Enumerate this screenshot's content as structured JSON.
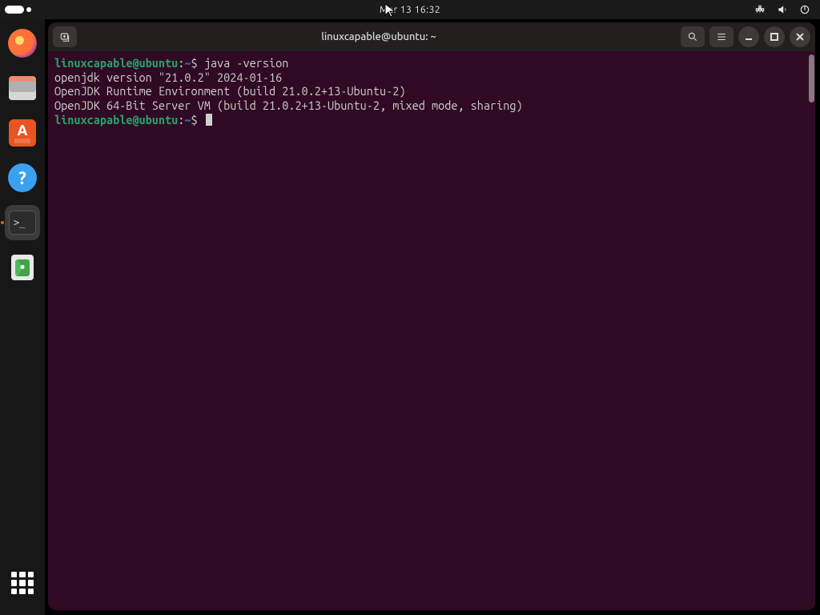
{
  "top_panel": {
    "clock": "Mar 13  16:32"
  },
  "dock": {
    "items": [
      {
        "name": "firefox",
        "label": "Firefox"
      },
      {
        "name": "files",
        "label": "Files"
      },
      {
        "name": "software",
        "label": "Ubuntu Software"
      },
      {
        "name": "help",
        "label": "Help",
        "glyph": "?"
      },
      {
        "name": "terminal",
        "label": "Terminal",
        "glyph": ">_",
        "active": true
      },
      {
        "name": "trash",
        "label": "Trash"
      }
    ]
  },
  "window": {
    "title": "linuxcapable@ubuntu: ~"
  },
  "terminal": {
    "prompt": {
      "user_host": "linuxcapable@ubuntu",
      "path": "~",
      "symbol": "$"
    },
    "lines": [
      {
        "type": "prompt",
        "cmd": "java -version"
      },
      {
        "type": "out",
        "text": "openjdk version \"21.0.2\" 2024-01-16"
      },
      {
        "type": "out",
        "text": "OpenJDK Runtime Environment (build 21.0.2+13-Ubuntu-2)"
      },
      {
        "type": "out",
        "text": "OpenJDK 64-Bit Server VM (build 21.0.2+13-Ubuntu-2, mixed mode, sharing)"
      },
      {
        "type": "prompt",
        "cmd": "",
        "cursor": true
      }
    ]
  }
}
